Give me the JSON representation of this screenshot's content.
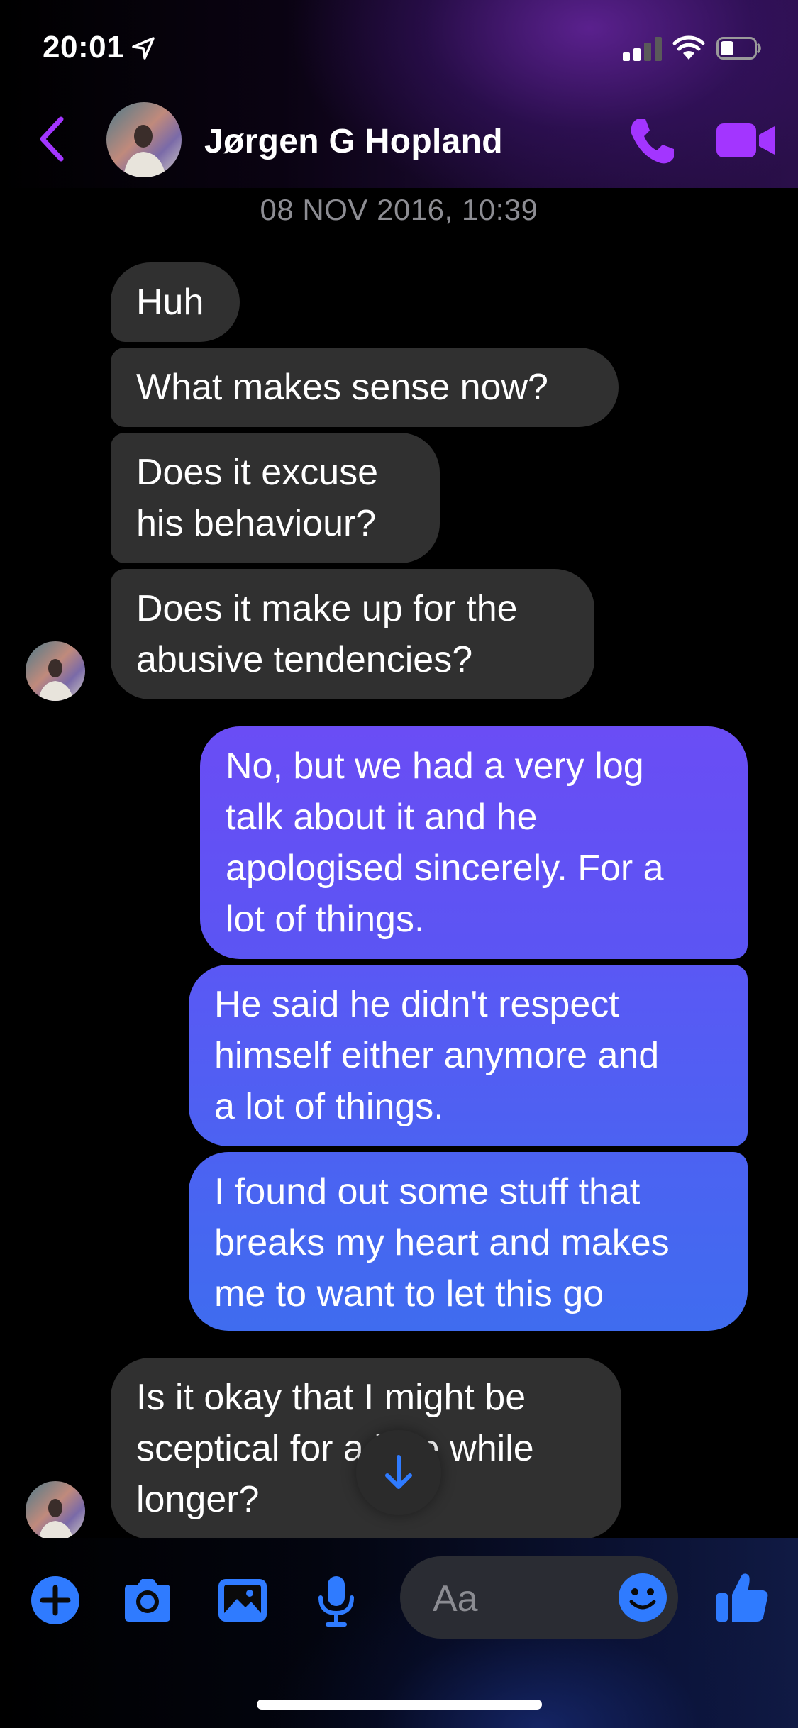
{
  "status_bar": {
    "time": "20:01"
  },
  "header": {
    "contact_name": "Jørgen G Hopland",
    "accent_color": "#a335ff"
  },
  "conversation": {
    "timestamp": "08 NOV 2016, 10:39",
    "messages": [
      {
        "direction": "incoming",
        "text": "Huh"
      },
      {
        "direction": "incoming",
        "text": "What makes sense now?"
      },
      {
        "direction": "incoming",
        "text": "Does it excuse\nhis behaviour?"
      },
      {
        "direction": "incoming",
        "text": "Does it make up for the\nabusive tendencies?"
      },
      {
        "direction": "outgoing",
        "text": "No, but we had a very log\ntalk about it and he\napologised sincerely. For a\nlot of things."
      },
      {
        "direction": "outgoing",
        "text": "He said he didn't respect\nhimself either anymore and\na lot of things."
      },
      {
        "direction": "outgoing",
        "text": "I found out some stuff that\nbreaks my heart and makes\nme to want to let this go"
      },
      {
        "direction": "incoming",
        "text": "Is it okay that I might be\nsceptical for a little while\nlonger?"
      }
    ]
  },
  "composer": {
    "placeholder": "Aa",
    "icon_color": "#2f7bff",
    "tools": [
      "plus-icon",
      "camera-icon",
      "gallery-icon",
      "microphone-icon",
      "emoji-icon",
      "thumbs-up-icon"
    ]
  },
  "colors": {
    "incoming_bubble": "#303030",
    "outgoing_gradient_top": "#6a4dff",
    "outgoing_gradient_bottom": "#3d6bf0"
  }
}
